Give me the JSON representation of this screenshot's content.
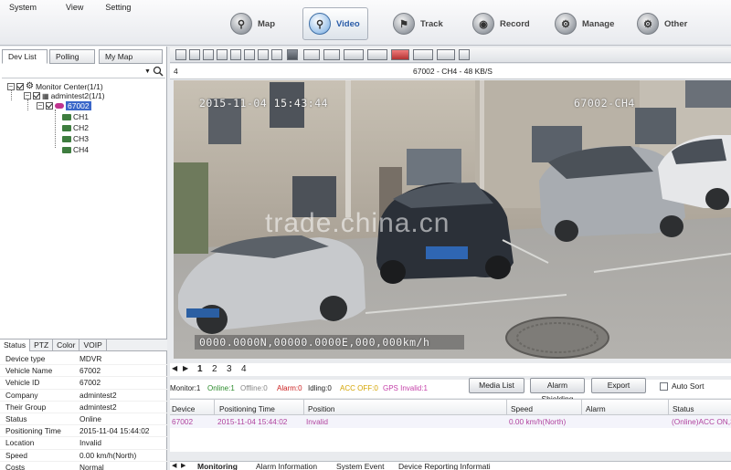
{
  "menu": [
    "System",
    "View",
    "Setting"
  ],
  "nav": [
    {
      "label": "Map",
      "icon": "map-icon"
    },
    {
      "label": "Video",
      "icon": "video-icon"
    },
    {
      "label": "Track",
      "icon": "track-icon"
    },
    {
      "label": "Record",
      "icon": "record-icon"
    },
    {
      "label": "Manage",
      "icon": "manage-icon"
    },
    {
      "label": "Other",
      "icon": "other-icon"
    }
  ],
  "left_tabs": [
    "Dev List",
    "Polling",
    "My Map"
  ],
  "tree": {
    "root": "Monitor Center(1/1)",
    "group": "admintest2(1/1)",
    "device": "67002",
    "channels": [
      "CH1",
      "CH2",
      "CH3",
      "CH4"
    ]
  },
  "bottom_tabs": [
    "Status",
    "PTZ",
    "Color",
    "VOIP"
  ],
  "properties": [
    {
      "k": "Device type",
      "v": "MDVR"
    },
    {
      "k": "Vehicle Name",
      "v": "67002"
    },
    {
      "k": "Vehicle ID",
      "v": "67002"
    },
    {
      "k": "Company",
      "v": "admintest2"
    },
    {
      "k": "Their Group",
      "v": "admintest2"
    },
    {
      "k": "Status",
      "v": "Online"
    },
    {
      "k": "Positioning Time",
      "v": "2015-11-04 15:44:02"
    },
    {
      "k": "Location",
      "v": "Invalid"
    },
    {
      "k": "Speed",
      "v": "0.00 km/h(North)"
    },
    {
      "k": "Costs",
      "v": "Normal"
    }
  ],
  "video": {
    "window_number": "4",
    "title": "67002 - CH4 - 48 KB/S",
    "osd_time": "2015-11-04 15:43:44",
    "osd_channel": "67002-CH4",
    "osd_gps": "0000.0000N,00000.0000E,000,000km/h",
    "watermark": "trade.china.cn"
  },
  "page_tabs": [
    "1",
    "2",
    "3",
    "4"
  ],
  "status": {
    "monitor": "Monitor:1",
    "online": "Online:1",
    "offline": "Offline:0",
    "alarm": "Alarm:0",
    "idling": "Idling:0",
    "acc": "ACC OFF:0",
    "gps": "GPS Invalid:1"
  },
  "actions": {
    "media": "Media List",
    "shield": "Alarm Shielding",
    "export": "Export",
    "autosort": "Auto Sort"
  },
  "grid": {
    "headers": [
      "Device",
      "Positioning Time",
      "Position",
      "Speed",
      "Alarm",
      "Status"
    ],
    "row": [
      "67002",
      "2015-11-04 15:44:02",
      "Invalid",
      "0.00 km/h(North)",
      "",
      "(Online)ACC ON,3"
    ]
  },
  "bottom_panel_tabs": [
    "Monitoring",
    "Alarm Information",
    "System Event",
    "Device Reporting Informati"
  ],
  "colors": {
    "accent": "#3b67c9",
    "row_text": "#b1449f",
    "online": "#2a8a2a",
    "alarm": "#cc2222",
    "acc": "#d4a400",
    "gps": "#c43fa8"
  }
}
